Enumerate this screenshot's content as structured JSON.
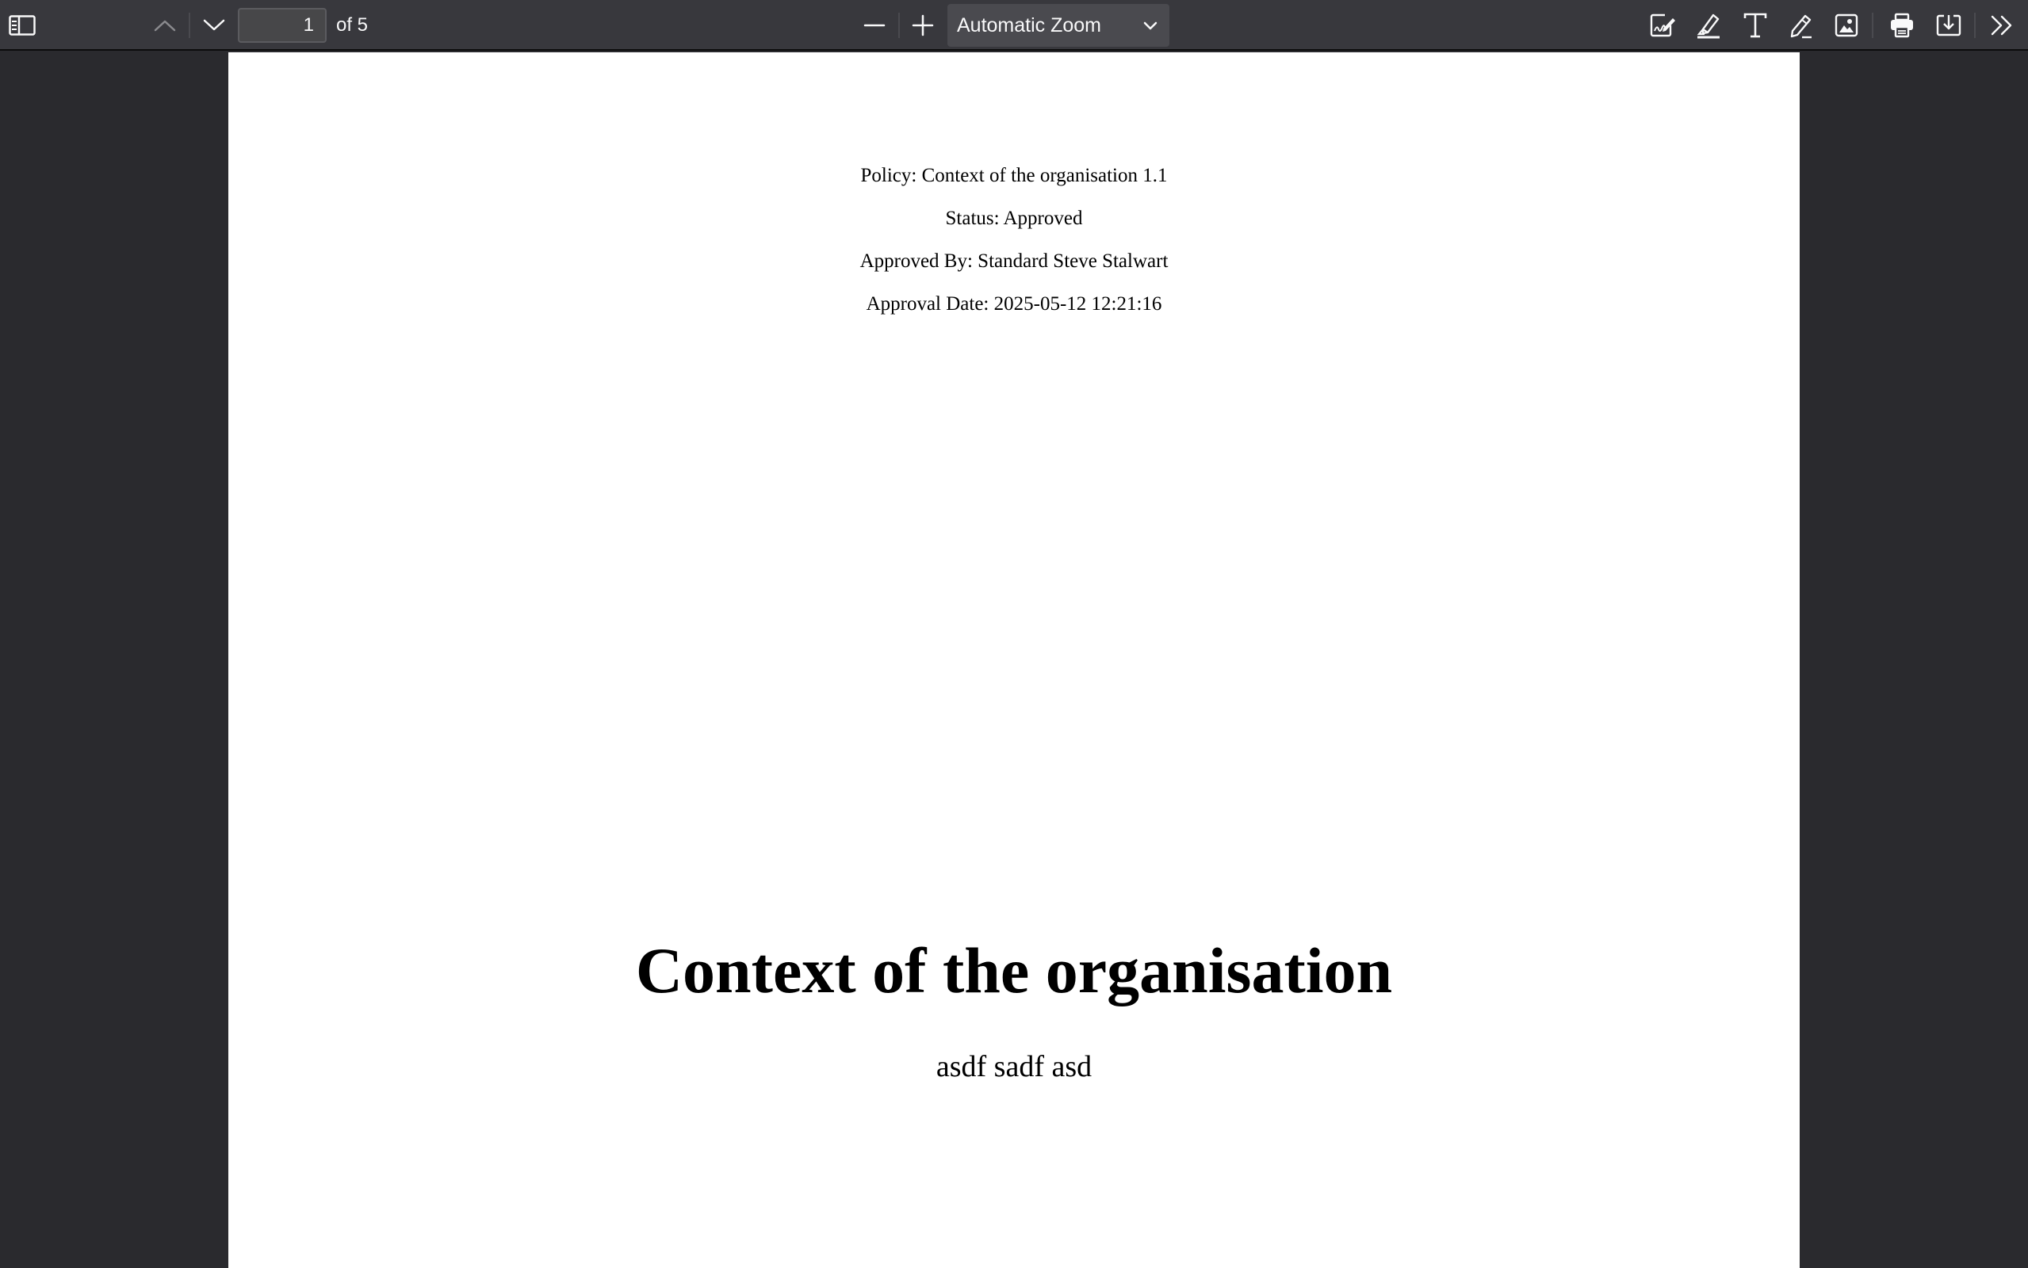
{
  "toolbar": {
    "icons": {
      "sidebar": "sidebar-toggle-icon",
      "prev": "chevron-up-icon",
      "next": "chevron-down-icon",
      "zoom_out": "minus-icon",
      "zoom_in": "plus-icon",
      "signature": "signature-icon",
      "highlight": "highlighter-icon",
      "text": "text-icon",
      "draw": "pen-icon",
      "image": "image-icon",
      "print": "printer-icon",
      "save": "download-icon",
      "tools": "double-chevron-right-icon"
    },
    "page_number": "1",
    "page_count": "of 5",
    "zoom_label": "Automatic Zoom"
  },
  "document": {
    "meta": {
      "policy": "Policy: Context of the organisation 1.1",
      "status": "Status: Approved",
      "approved_by": "Approved By: Standard Steve Stalwart",
      "approval_date": "Approval Date: 2025-05-12 12:21:16"
    },
    "title": "Context of the organisation",
    "body": "asdf sadf asd"
  },
  "colors": {
    "toolbar_bg": "#38383d",
    "viewer_bg": "#2a2a2e",
    "page_bg": "#ffffff",
    "icon": "#f9f9fa",
    "icon_disabled": "#8a8a8e"
  }
}
